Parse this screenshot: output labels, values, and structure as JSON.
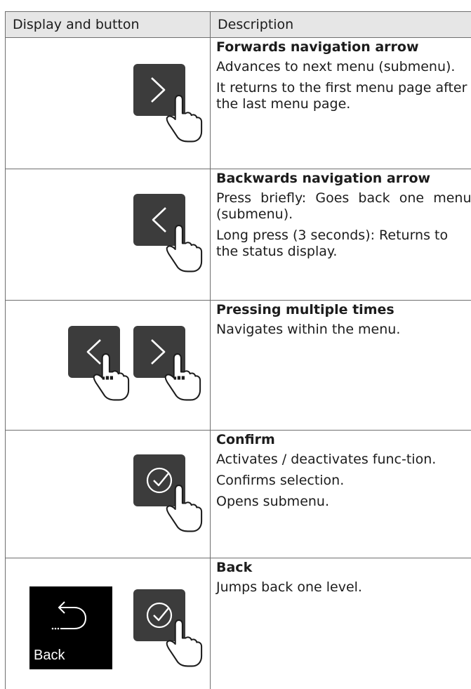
{
  "table": {
    "headers": [
      "Display and button",
      "Description"
    ],
    "rows": [
      {
        "icon": "forward-arrow-button-icon",
        "title": "Forwards navigation arrow",
        "lines": [
          "Advances to next menu (submenu).",
          "It returns to the first menu page after the last menu page."
        ]
      },
      {
        "icon": "backward-arrow-button-icon",
        "title": "Backwards navigation arrow",
        "lines": [
          "Press briefly: Goes back one menu (submenu).",
          "Long press (3 seconds): Returns to the status display."
        ]
      },
      {
        "icon": "back-and-forward-arrow-buttons-icon",
        "title": "Pressing multiple times",
        "lines": [
          "Navigates within the menu."
        ]
      },
      {
        "icon": "confirm-check-button-icon",
        "title": "Confirm",
        "lines": [
          "Activates / deactivates func-tion.",
          "Confirms selection.",
          "Opens submenu."
        ]
      },
      {
        "icon": "confirm-check-button-icon",
        "display_label": "Back",
        "title": "Back",
        "lines": [
          "Jumps back one level."
        ]
      }
    ]
  },
  "colors": {
    "button_fill": "#3c3c3c",
    "header_fill": "#e6e6e6",
    "border": "#6f6f6f",
    "display_fill": "#000000"
  }
}
